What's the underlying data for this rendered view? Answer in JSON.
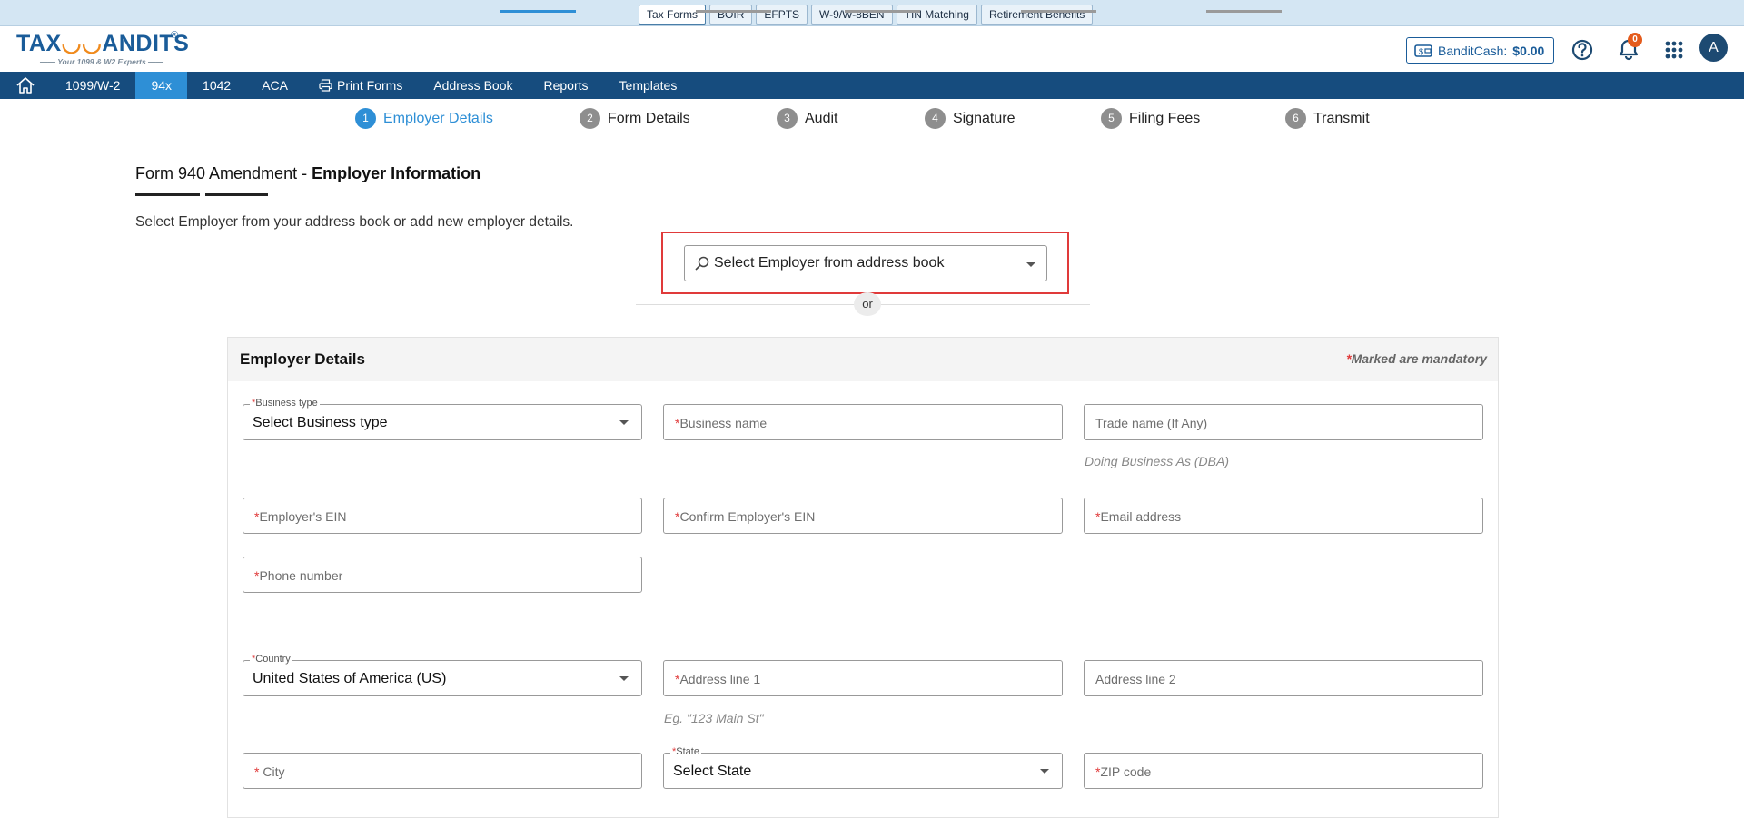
{
  "top_tabs": [
    "Tax Forms",
    "BOIR",
    "EFPTS",
    "W-9/W-8BEN",
    "TIN Matching",
    "Retirement Benefits"
  ],
  "logo": {
    "text_left": "TAX",
    "text_owl": "◡◡",
    "text_right": "ANDITS",
    "registered": "®",
    "tagline": "—— Your 1099 & W2 Experts ——"
  },
  "header": {
    "bandit_cash_label": "BanditCash:",
    "bandit_cash_amount": "$0.00",
    "notification_count": "0",
    "avatar_initial": "A"
  },
  "nav": {
    "items": [
      "1099/W-2",
      "94x",
      "1042",
      "ACA",
      "Print Forms",
      "Address Book",
      "Reports",
      "Templates"
    ],
    "active": "94x"
  },
  "stepper": {
    "steps": [
      {
        "num": "1",
        "label": "Employer Details"
      },
      {
        "num": "2",
        "label": "Form Details"
      },
      {
        "num": "3",
        "label": "Audit"
      },
      {
        "num": "4",
        "label": "Signature"
      },
      {
        "num": "5",
        "label": "Filing Fees"
      },
      {
        "num": "6",
        "label": "Transmit"
      }
    ],
    "active_step": 1
  },
  "page": {
    "title_normal": "Form 940 Amendment - ",
    "title_bold": "Employer Information",
    "subtitle": "Select Employer from your address book or add new employer details.",
    "employer_select_placeholder": "Select Employer from address book",
    "or_text": "or"
  },
  "panel": {
    "title": "Employer Details",
    "mandatory_star": "*",
    "mandatory_text": "Marked are mandatory",
    "fields": {
      "business_type_label": "Business type",
      "business_type_value": "Select Business type",
      "business_name": "Business name",
      "trade_name": "Trade name (If Any)",
      "trade_name_help": "Doing Business As (DBA)",
      "ein": "Employer's EIN",
      "confirm_ein": "Confirm Employer's EIN",
      "email": "Email address",
      "phone": "Phone number",
      "country_label": "Country",
      "country_value": "United States of America (US)",
      "address1": "Address line 1",
      "address1_help": "Eg. \"123 Main St\"",
      "address2": "Address line 2",
      "city": " City",
      "state_label": "State",
      "state_value": "Select State",
      "zip": "ZIP code"
    }
  },
  "colors": {
    "brand_blue": "#164c7e",
    "accent_blue": "#2e8fd6",
    "required_red": "#e03a3a",
    "highlight_red": "#e03a3a"
  }
}
